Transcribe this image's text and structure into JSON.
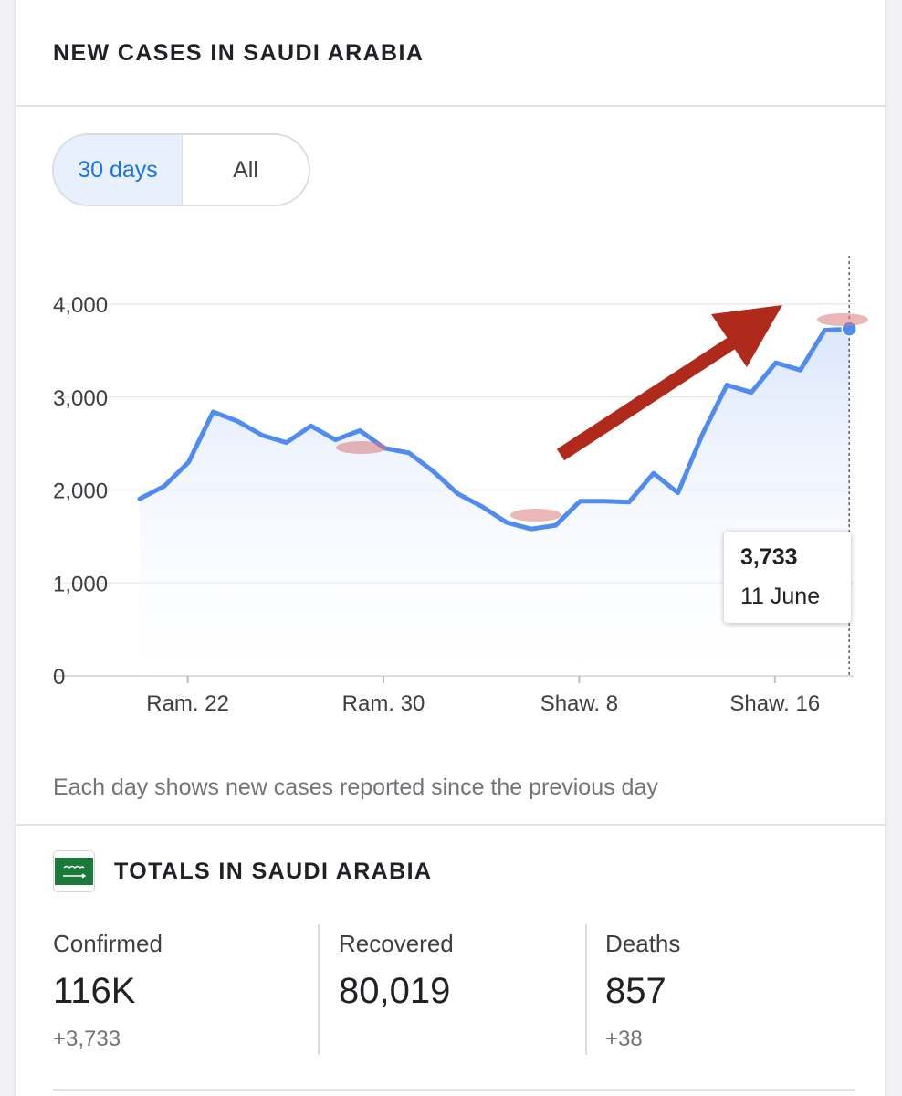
{
  "header": {
    "title": "NEW CASES IN SAUDI ARABIA"
  },
  "range_toggle": {
    "options": [
      "30 days",
      "All"
    ],
    "selected": "30 days"
  },
  "tooltip": {
    "value": "3,733",
    "date": "11 June"
  },
  "footnote": "Each day shows new cases reported since the previous day",
  "totals": {
    "title": "TOTALS IN SAUDI ARABIA",
    "flag_icon": "saudi-arabia-flag-icon",
    "stats": [
      {
        "label": "Confirmed",
        "value": "116K",
        "delta": "+3,733"
      },
      {
        "label": "Recovered",
        "value": "80,019",
        "delta": ""
      },
      {
        "label": "Deaths",
        "value": "857",
        "delta": "+38"
      }
    ]
  },
  "colors": {
    "line": "#4f8bf0",
    "accent": "#1a73e8",
    "arrow": "#b02a1b",
    "flag": "#1b7a3a"
  },
  "chart_data": {
    "type": "area",
    "title": "",
    "xlabel": "",
    "ylabel": "",
    "ylim": [
      0,
      4000
    ],
    "yticks": [
      0,
      1000,
      2000,
      3000,
      4000
    ],
    "ytick_labels": [
      "0",
      "1,000",
      "2,000",
      "3,000",
      "4,000"
    ],
    "xtick_labels": [
      {
        "label": "Ram. 22",
        "index": 2
      },
      {
        "label": "Ram. 30",
        "index": 10
      },
      {
        "label": "Shaw. 8",
        "index": 18
      },
      {
        "label": "Shaw. 16",
        "index": 26
      }
    ],
    "grid": true,
    "series": [
      {
        "values": [
          1905,
          2040,
          2300,
          2840,
          2740,
          2590,
          2510,
          2690,
          2540,
          2640,
          2450,
          2400,
          2200,
          1960,
          1820,
          1650,
          1580,
          1620,
          1880,
          1880,
          1870,
          2180,
          1970,
          2600,
          3130,
          3050,
          3370,
          3290,
          3720,
          3733
        ]
      }
    ],
    "highlight": {
      "index": 29,
      "value": 3733
    }
  }
}
